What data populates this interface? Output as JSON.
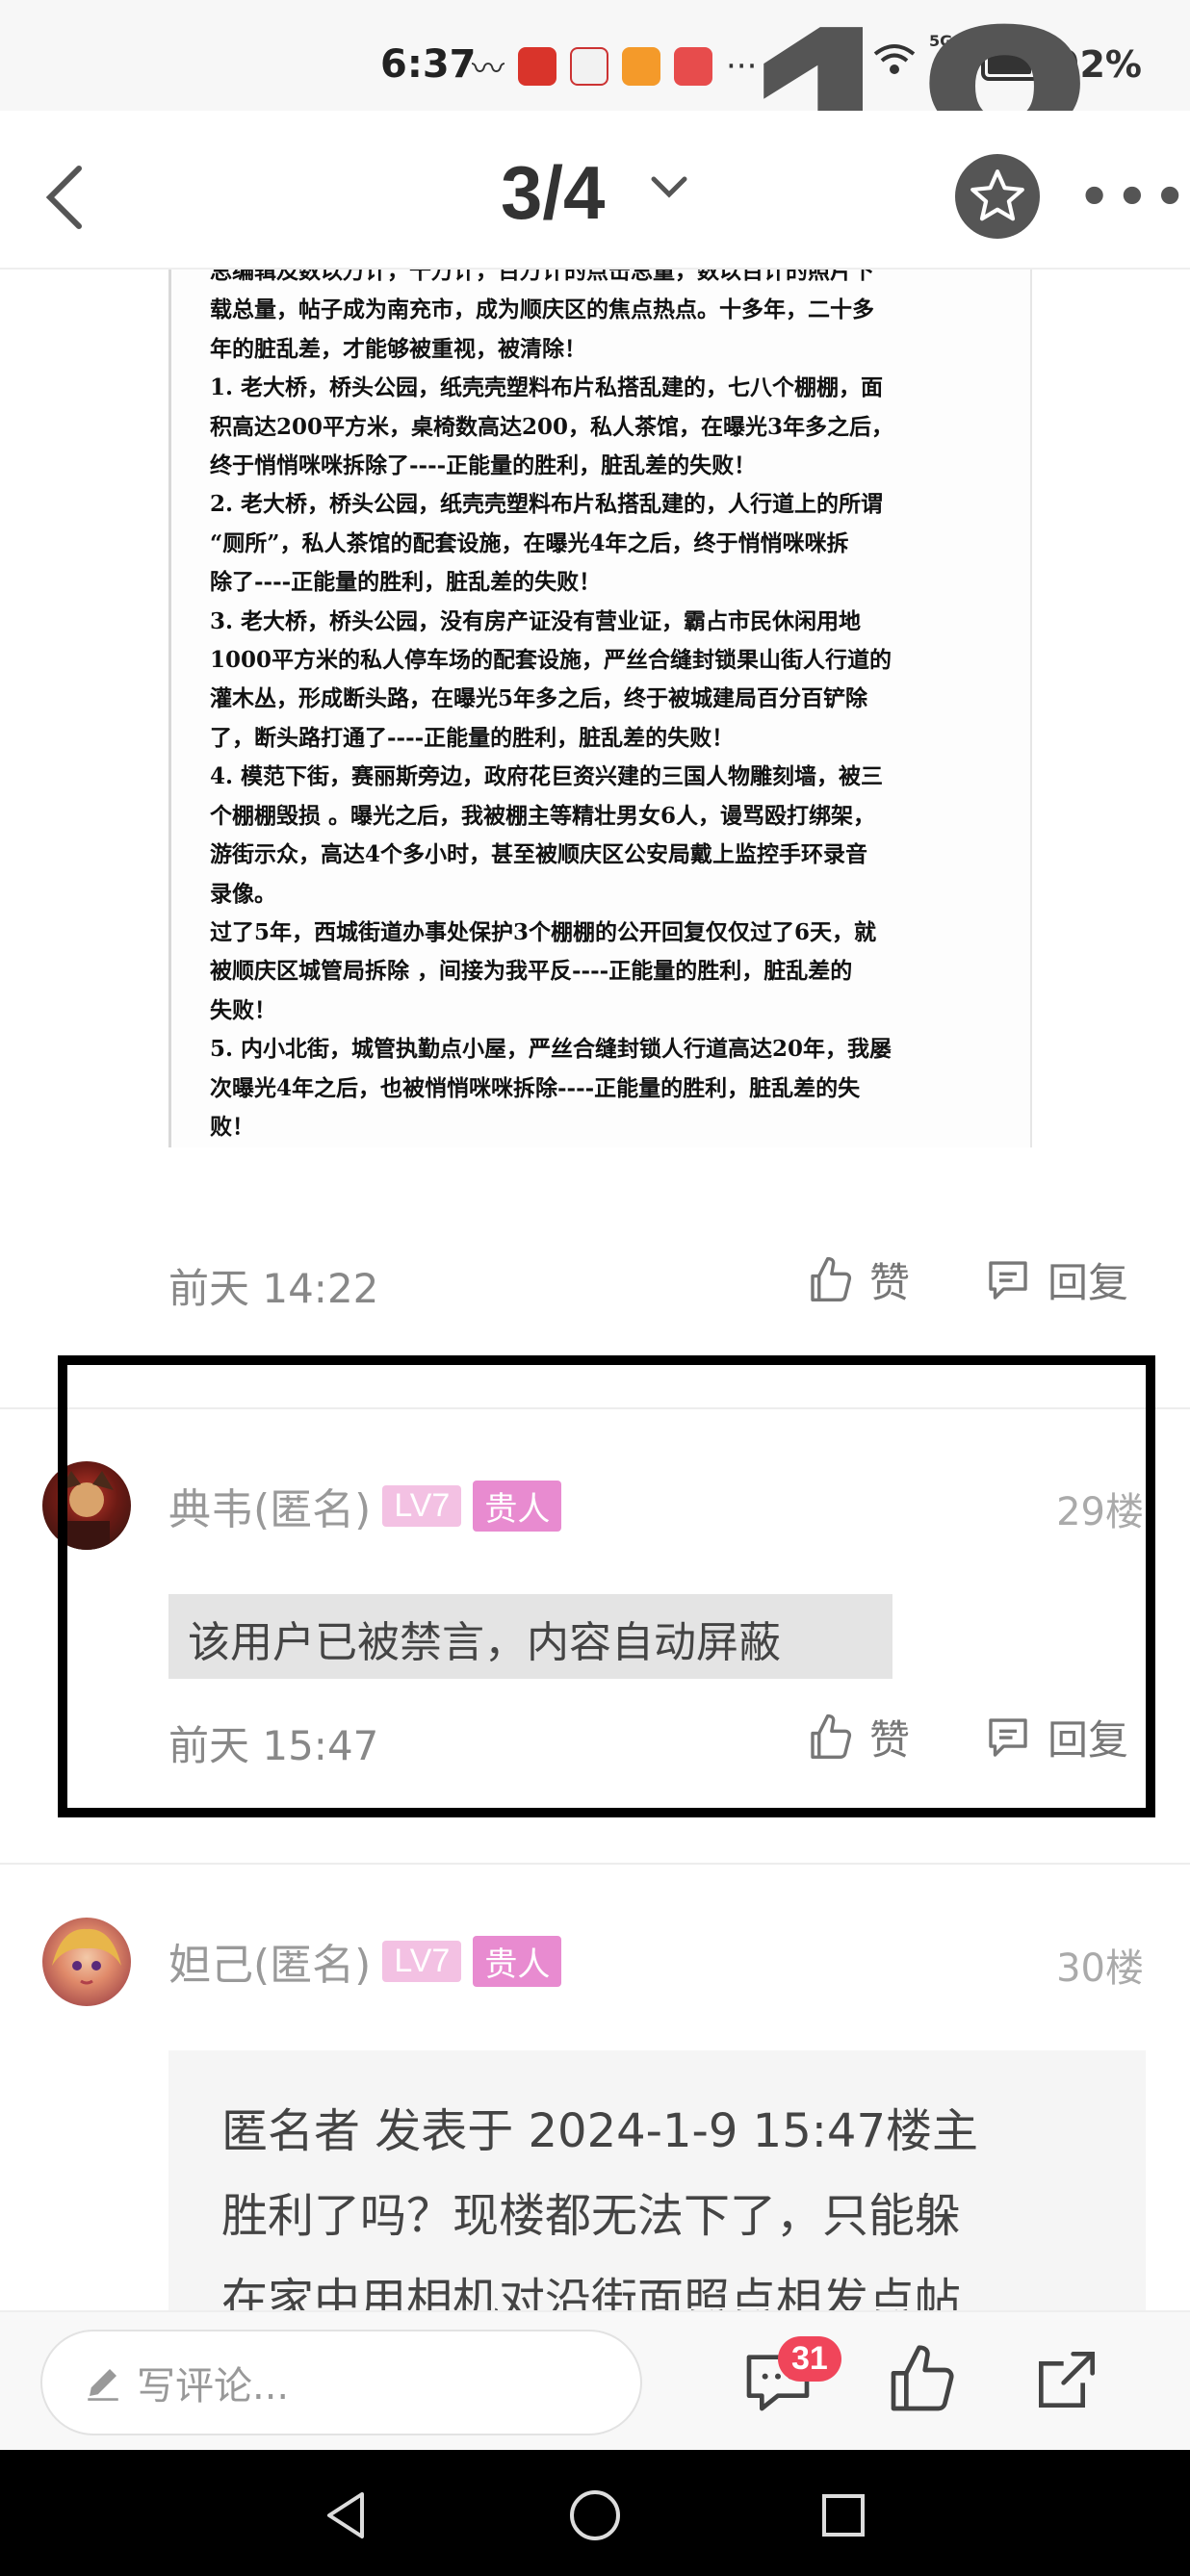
{
  "status_bar": {
    "time": "6:37",
    "network": "5G",
    "battery": "92%",
    "overlay_number": "18"
  },
  "nav": {
    "page_indicator": "3/4"
  },
  "post_image_lines": [
    "总编辑及数以万计，千万计，百万计的点击总量，数以百计的照片下",
    "载总量，帖子成为南充市，成为顺庆区的焦点热点。十多年，二十多",
    "年的脏乱差，才能够被重视，被清除！",
    "1. 老大桥，桥头公园，纸壳壳塑料布片私搭乱建的，七八个棚棚，面",
    "积高达200平方米，桌椅数高达200，私人茶馆，在曝光3年多之后，",
    "终于悄悄咪咪拆除了----正能量的胜利，脏乱差的失败！",
    "2. 老大桥，桥头公园，纸壳壳塑料布片私搭乱建的，人行道上的所谓",
    "“厕所”，私人茶馆的配套设施，在曝光4年之后，终于悄悄咪咪拆",
    "除了----正能量的胜利，脏乱差的失败！",
    "3. 老大桥，桥头公园，没有房产证没有营业证，霸占市民休闲用地",
    "1000平方米的私人停车场的配套设施，严丝合缝封锁果山街人行道的",
    "灌木丛，形成断头路，在曝光5年多之后，终于被城建局百分百铲除",
    "了，断头路打通了----正能量的胜利，脏乱差的失败！",
    "4. 模范下街，赛丽斯旁边，政府花巨资兴建的三国人物雕刻墙，被三",
    "个棚棚毁损 。曝光之后，我被棚主等精壮男女6人，谩骂殴打绑架，",
    "游街示众，高达4个多小时，甚至被顺庆区公安局戴上监控手环录音",
    "录像。",
    "过了5年，西城街道办事处保护3个棚棚的公开回复仅仅过了6天，就",
    "被顺庆区城管局拆除 ，间接为我平反----正能量的胜利，脏乱差的",
    "失败！",
    "5. 内小北街，城管执勤点小屋，严丝合缝封锁人行道高达20年，我屡",
    "次曝光4年之后，也被悄悄咪咪拆除----正能量的胜利，脏乱差的失",
    "败！"
  ],
  "first_meta": {
    "time": "前天 14:22",
    "like": "赞",
    "reply": "回复"
  },
  "comment1": {
    "username": "典韦(匿名)",
    "level": "LV7",
    "vip": "贵人",
    "floor": "29楼",
    "content": "该用户已被禁言，内容自动屏蔽",
    "time": "前天 15:47",
    "like": "赞",
    "reply": "回复"
  },
  "comment2": {
    "username": "妲己(匿名)",
    "level": "LV7",
    "vip": "贵人",
    "floor": "30楼",
    "quote_lines": [
      "匿名者 发表于 2024-1-9 15:47楼主",
      "胜利了吗？现楼都无法下了，只能躲",
      "在家中用相机对沿街面照点相发点帖"
    ]
  },
  "bottom_bar": {
    "placeholder": "写评论...",
    "comment_count": "31"
  },
  "colors": {
    "accent_red": "#f0455a",
    "badge_lv": "#f3c1e3",
    "badge_vip": "#e88bd0"
  }
}
